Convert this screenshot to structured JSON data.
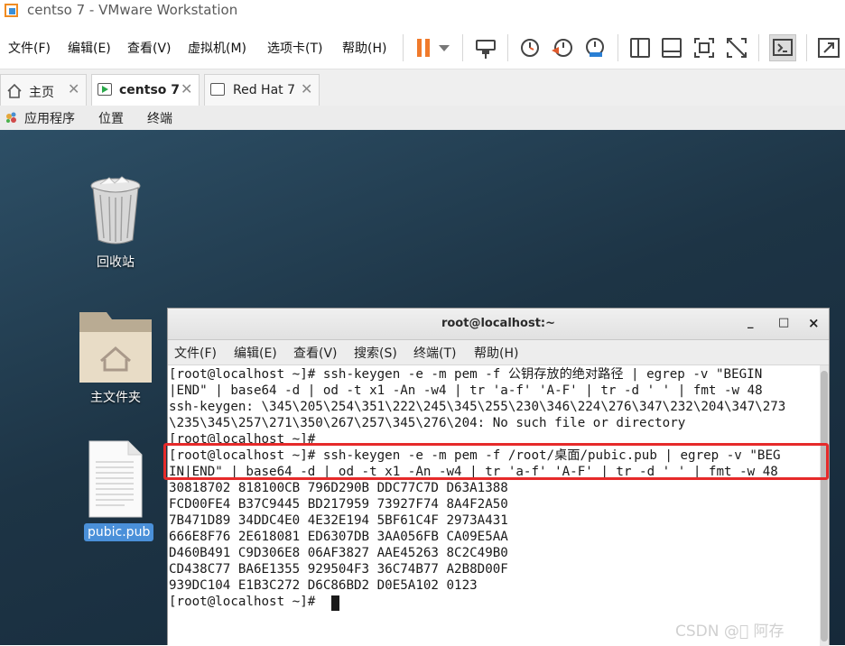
{
  "window": {
    "title": "centso 7 - VMware Workstation"
  },
  "menu": [
    "文件(F)",
    "编辑(E)",
    "查看(V)",
    "虚拟机(M)",
    "选项卡(T)",
    "帮助(H)"
  ],
  "toolbar": {
    "icons": [
      "pause-icon",
      "dropdown-icon",
      "send-ctrl-alt-del-icon",
      "snapshot-icon",
      "revert-snapshot-icon",
      "snapshot-manager-icon",
      "library-icon",
      "thumbnail-icon",
      "fit-guest-icon",
      "unity-icon",
      "console-icon",
      "fullscreen-icon"
    ],
    "colors": {
      "pause": "#f07a2b",
      "snapshot_accent": "#e05a2c",
      "manager_accent": "#2a7fd4"
    }
  },
  "tabs": [
    {
      "label": "主页",
      "active": false
    },
    {
      "label": "centso 7",
      "active": true
    },
    {
      "label": "Red Hat 7",
      "active": false
    }
  ],
  "gnome_topbar": {
    "applications": "应用程序",
    "places": "位置",
    "terminal": "终端"
  },
  "desktop": {
    "icons": [
      {
        "label": "回收站",
        "icon": "trash-icon"
      },
      {
        "label": "主文件夹",
        "icon": "home-folder-icon"
      },
      {
        "label": "pubic.pub",
        "icon": "text-file-icon",
        "selected": true
      }
    ]
  },
  "terminal": {
    "title": "root@localhost:~",
    "controls": [
      "_",
      "□",
      "×"
    ],
    "menu": [
      "文件(F)",
      "编辑(E)",
      "查看(V)",
      "搜索(S)",
      "终端(T)",
      "帮助(H)"
    ],
    "lines": [
      "[root@localhost ~]# ssh-keygen -e -m pem -f 公钥存放的绝对路径 | egrep -v \"BEGIN",
      "|END\" | base64 -d | od -t x1 -An -w4 | tr 'a-f' 'A-F' | tr -d ' ' | fmt -w 48",
      "ssh-keygen: \\345\\205\\254\\351\\222\\245\\345\\255\\230\\346\\224\\276\\347\\232\\204\\347\\273",
      "\\235\\345\\257\\271\\350\\267\\257\\345\\276\\204: No such file or directory",
      "[root@localhost ~]#",
      "[root@localhost ~]# ssh-keygen -e -m pem -f /root/桌面/pubic.pub | egrep -v \"BEG",
      "IN|END\" | base64 -d | od -t x1 -An -w4 | tr 'a-f' 'A-F' | tr -d ' ' | fmt -w 48",
      "30818702 818100CB 796D290B DDC77C7D D63A1388",
      "FCD00FE4 B37C9445 BD217959 73927F74 8A4F2A50",
      "7B471D89 34DDC4E0 4E32E194 5BF61C4F 2973A431",
      "666E8F76 2E618081 ED6307DB 3AA056FB CA09E5AA",
      "D460B491 C9D306E8 06AF3827 AAE45263 8C2C49B0",
      "CD438C77 BA6E1355 929504F3 36C74B77 A2B8D00F",
      "939DC104 E1B3C272 D6C86BD2 D0E5A102 0123",
      "[root@localhost ~]# "
    ],
    "highlight_color": "#e62a2a"
  },
  "watermark": "CSDN @\u0000 阿存"
}
